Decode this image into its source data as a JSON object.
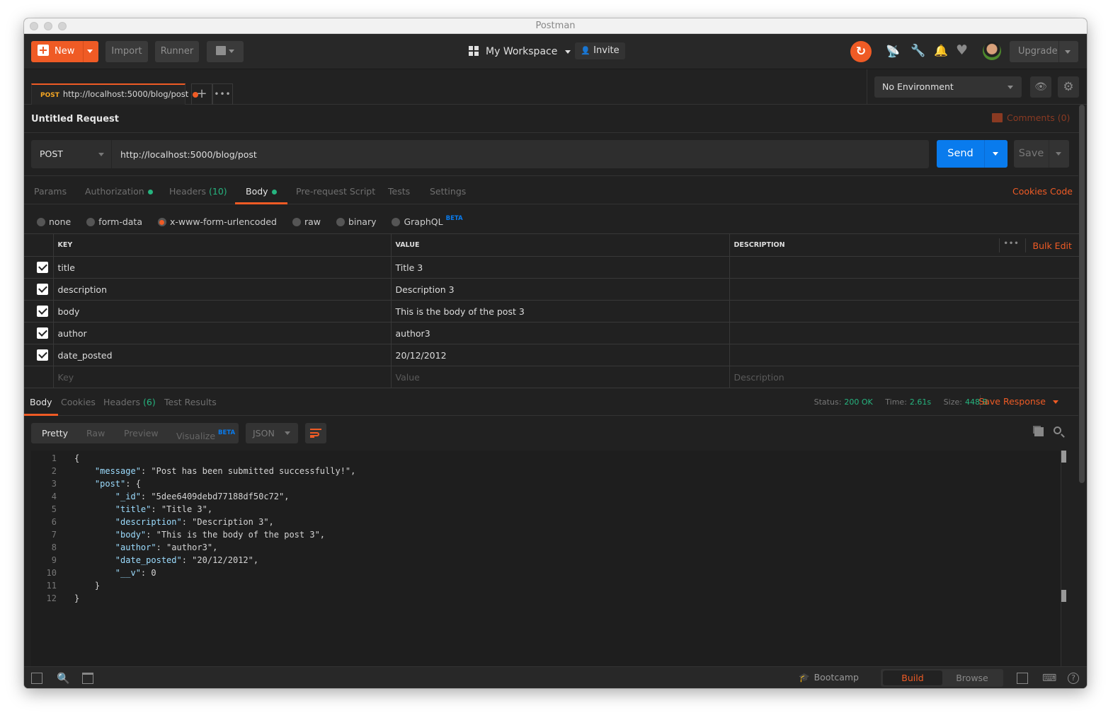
{
  "window": {
    "title": "Postman"
  },
  "header": {
    "new_label": "New",
    "import_label": "Import",
    "runner_label": "Runner",
    "workspace_label": "My Workspace",
    "invite_label": "Invite",
    "upgrade_label": "Upgrade",
    "icons": [
      "sync-icon",
      "satellite-icon",
      "wrench-icon",
      "bell-icon",
      "heart-icon",
      "avatar"
    ]
  },
  "tabs": [
    {
      "method": "POST",
      "url": "http://localhost:5000/blog/post",
      "unsaved": true
    }
  ],
  "environment": {
    "selected": "No Environment"
  },
  "request": {
    "name": "Untitled Request",
    "comments_label": "Comments (0)",
    "method": "POST",
    "url": "http://localhost:5000/blog/post",
    "send_label": "Send",
    "save_label": "Save",
    "tabs": [
      {
        "label": "Params"
      },
      {
        "label": "Authorization",
        "dot": true
      },
      {
        "label": "Headers",
        "count": "(10)"
      },
      {
        "label": "Body",
        "dot": true,
        "active": true
      },
      {
        "label": "Pre-request Script"
      },
      {
        "label": "Tests"
      },
      {
        "label": "Settings"
      }
    ],
    "links": {
      "cookies": "Cookies",
      "code": "Code"
    },
    "body_types": [
      {
        "label": "none"
      },
      {
        "label": "form-data"
      },
      {
        "label": "x-www-form-urlencoded",
        "selected": true
      },
      {
        "label": "raw"
      },
      {
        "label": "binary"
      },
      {
        "label": "GraphQL",
        "badge": "BETA"
      }
    ],
    "table": {
      "headers": {
        "key": "KEY",
        "value": "VALUE",
        "description": "DESCRIPTION"
      },
      "bulk_edit_label": "Bulk Edit",
      "rows": [
        {
          "checked": true,
          "key": "title",
          "value": "Title 3",
          "description": ""
        },
        {
          "checked": true,
          "key": "description",
          "value": "Description 3",
          "description": ""
        },
        {
          "checked": true,
          "key": "body",
          "value": "This is the body of the post 3",
          "description": ""
        },
        {
          "checked": true,
          "key": "author",
          "value": "author3",
          "description": ""
        },
        {
          "checked": true,
          "key": "date_posted",
          "value": "20/12/2012",
          "description": ""
        }
      ],
      "placeholders": {
        "key": "Key",
        "value": "Value",
        "description": "Description"
      }
    }
  },
  "response": {
    "tabs": [
      {
        "label": "Body",
        "active": true
      },
      {
        "label": "Cookies"
      },
      {
        "label": "Headers",
        "count": "(6)"
      },
      {
        "label": "Test Results"
      }
    ],
    "status_label": "Status:",
    "status": "200 OK",
    "time_label": "Time:",
    "time": "2.61s",
    "size_label": "Size:",
    "size": "448 B",
    "save_response_label": "Save Response",
    "formats": [
      {
        "label": "Pretty",
        "active": true
      },
      {
        "label": "Raw"
      },
      {
        "label": "Preview"
      },
      {
        "label": "Visualize",
        "badge": "BETA"
      }
    ],
    "language": "JSON",
    "lines": [
      "{",
      "    \"message\": \"Post has been submitted successfully!\",",
      "    \"post\": {",
      "        \"_id\": \"5dee6409debd77188df50c72\",",
      "        \"title\": \"Title 3\",",
      "        \"description\": \"Description 3\",",
      "        \"body\": \"This is the body of the post 3\",",
      "        \"author\": \"author3\",",
      "        \"date_posted\": \"20/12/2012\",",
      "        \"__v\": 0",
      "    }",
      "}"
    ]
  },
  "footer": {
    "bootcamp_label": "Bootcamp",
    "build_label": "Build",
    "browse_label": "Browse",
    "active_mode": "Build"
  },
  "colors": {
    "accent": "#ef5b25",
    "send": "#097bed",
    "success": "#26b47f"
  }
}
